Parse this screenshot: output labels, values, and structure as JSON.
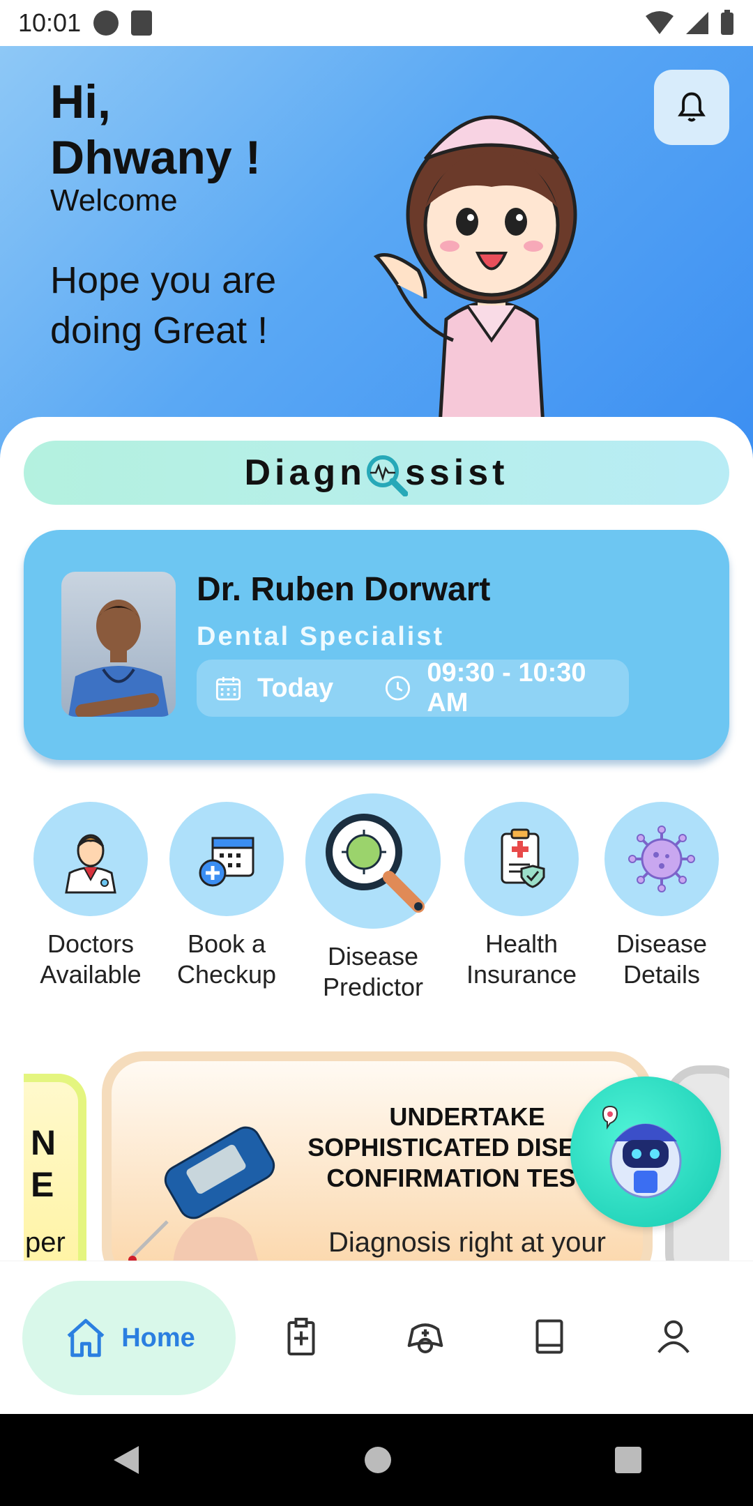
{
  "status_bar": {
    "time": "10:01"
  },
  "header": {
    "greeting": "Hi,",
    "user_name": "Dhwany !",
    "welcome": "Welcome",
    "message": "Hope you are doing Great !"
  },
  "brand": {
    "part1": "Diagn",
    "part2": "ssist"
  },
  "appointment": {
    "doctor_name": "Dr. Ruben Dorwart",
    "specialty": "Dental  Specialist",
    "day": "Today",
    "time": "09:30 - 10:30 AM"
  },
  "quick_actions": [
    {
      "label": "Doctors Available",
      "icon": "doctor-icon"
    },
    {
      "label": "Book a Checkup",
      "icon": "calendar-plus-icon"
    },
    {
      "label": "Disease Predictor",
      "icon": "virus-magnifier-icon"
    },
    {
      "label": "Health Insurance",
      "icon": "insurance-clipboard-icon"
    },
    {
      "label": "Disease Details",
      "icon": "virus-icon"
    }
  ],
  "banner": {
    "left_card_lines": [
      "N",
      "E",
      "per"
    ],
    "headline": "UNDERTAKE SOPHISTICATED DISEASE CONFIRMATION TESTS",
    "subtext": "Diagnosis right at your"
  },
  "bottom_nav": {
    "home_label": "Home",
    "items": [
      "home-icon",
      "clipboard-plus-icon",
      "medical-bag-icon",
      "book-icon",
      "profile-icon"
    ]
  },
  "colors": {
    "header_gradient_start": "#8ec8f6",
    "header_gradient_end": "#3b8ef2",
    "appointment_card": "#6dc6f2",
    "quick_action_circle": "#aee0fa",
    "home_pill": "#d9f8ea",
    "home_accent": "#2b7fe0",
    "bot_button": "#14c9b1"
  }
}
